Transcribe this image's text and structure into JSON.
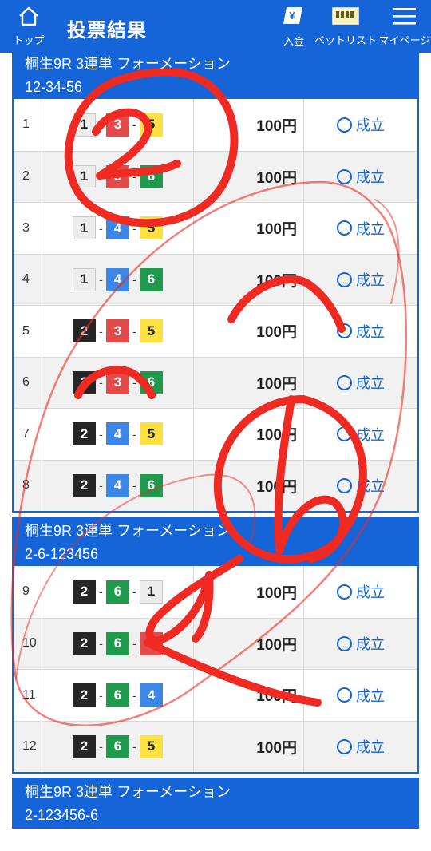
{
  "header": {
    "home_label": "トップ",
    "title": "投票結果",
    "deposit_label": "入金",
    "betlist_label": "ベットリスト",
    "mypage_label": "マイページ",
    "deposit_icon_glyph": "¥",
    "bg_color": "#1565d8"
  },
  "sections": [
    {
      "title": "桐生9R 3連単 フォーメーション",
      "combo": "12-34-56",
      "rows": [
        {
          "num": "1",
          "boats": [
            "1",
            "3",
            "5"
          ],
          "amount": "100円",
          "status": "成立"
        },
        {
          "num": "2",
          "boats": [
            "1",
            "3",
            "6"
          ],
          "amount": "100円",
          "status": "成立"
        },
        {
          "num": "3",
          "boats": [
            "1",
            "4",
            "5"
          ],
          "amount": "100円",
          "status": "成立"
        },
        {
          "num": "4",
          "boats": [
            "1",
            "4",
            "6"
          ],
          "amount": "100円",
          "status": "成立"
        },
        {
          "num": "5",
          "boats": [
            "2",
            "3",
            "5"
          ],
          "amount": "100円",
          "status": "成立"
        },
        {
          "num": "6",
          "boats": [
            "2",
            "3",
            "6"
          ],
          "amount": "100円",
          "status": "成立"
        },
        {
          "num": "7",
          "boats": [
            "2",
            "4",
            "5"
          ],
          "amount": "100円",
          "status": "成立"
        },
        {
          "num": "8",
          "boats": [
            "2",
            "4",
            "6"
          ],
          "amount": "100円",
          "status": "成立"
        }
      ]
    },
    {
      "title": "桐生9R 3連単 フォーメーション",
      "combo": "2-6-123456",
      "rows": [
        {
          "num": "9",
          "boats": [
            "2",
            "6",
            "1"
          ],
          "amount": "100円",
          "status": "成立"
        },
        {
          "num": "10",
          "boats": [
            "2",
            "6",
            "3"
          ],
          "amount": "100円",
          "status": "成立"
        },
        {
          "num": "11",
          "boats": [
            "2",
            "6",
            "4"
          ],
          "amount": "100円",
          "status": "成立"
        },
        {
          "num": "12",
          "boats": [
            "2",
            "6",
            "5"
          ],
          "amount": "100円",
          "status": "成立"
        }
      ]
    },
    {
      "title": "桐生9R 3連単 フォーメーション",
      "combo": "2-123456-6",
      "rows": []
    }
  ],
  "boat_colors": {
    "1": "#ececec",
    "2": "#262626",
    "3": "#e34b4b",
    "4": "#3b86e6",
    "5": "#fde13f",
    "6": "#1f9a4d"
  },
  "annotation_color": "#ee2a22"
}
